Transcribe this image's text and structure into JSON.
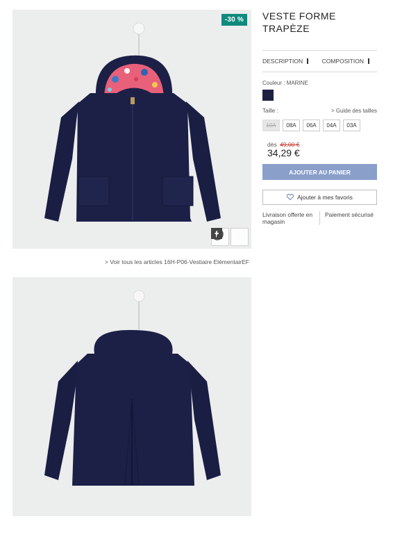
{
  "product": {
    "title": "VESTE FORME TRAPÈZE",
    "discount_badge": "-30 %",
    "see_all_link": "> Voir tous les articles 16H-P06-Vestiaire ElémentairEF"
  },
  "tabs": [
    {
      "label": "Description"
    },
    {
      "label": "Composition"
    }
  ],
  "color": {
    "label": "Couleur : MARINE",
    "swatch_hex": "#1c2040"
  },
  "size": {
    "label": "Taille :",
    "guide_link": "> Guide des tailles",
    "options": [
      {
        "label": "10A",
        "available": false
      },
      {
        "label": "08A",
        "available": true
      },
      {
        "label": "06A",
        "available": true
      },
      {
        "label": "04A",
        "available": true
      },
      {
        "label": "03A",
        "available": true
      }
    ]
  },
  "price": {
    "prefix": "dès",
    "old": "49,00 €",
    "current": "34,29 €"
  },
  "actions": {
    "add_to_cart": "Ajouter au panier",
    "add_to_favorites": "Ajouter à mes favoris"
  },
  "info": {
    "delivery": "Livraison offerte en magasin",
    "payment": "Paiement sécurisé"
  },
  "colors": {
    "accent": "#8a9fca",
    "badge": "#0f8a7e",
    "jacket": "#1c2046",
    "photo_bg": "#eceded"
  },
  "icons": {
    "facebook": "facebook-icon",
    "pinterest": "pinterest-icon",
    "heart": "heart-icon"
  }
}
